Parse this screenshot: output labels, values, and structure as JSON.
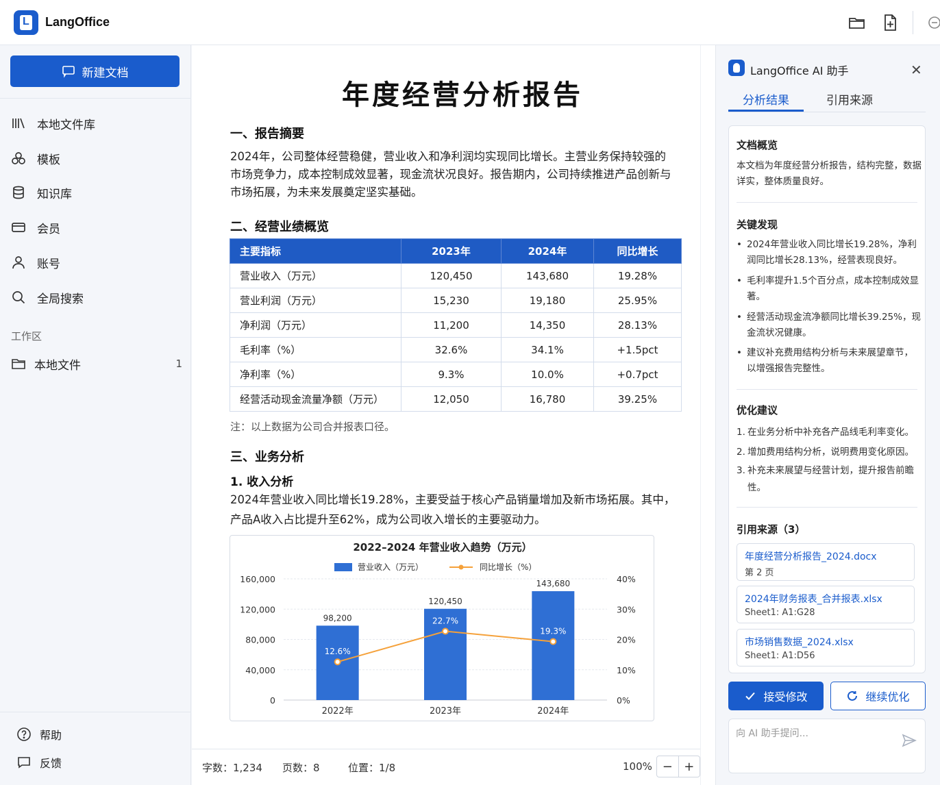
{
  "app": {
    "title": "LangOffice"
  },
  "colors": {
    "primary": "#1a5ccc",
    "line": "#f5a13a",
    "bar": "#2f6fd4"
  },
  "sidebar": {
    "new_doc": "新建文档",
    "items": [
      {
        "label": "本地文件库",
        "icon": "library-icon"
      },
      {
        "label": "模板",
        "icon": "template-icon"
      },
      {
        "label": "知识库",
        "icon": "database-icon"
      },
      {
        "label": "会员",
        "icon": "card-icon"
      },
      {
        "label": "账号",
        "icon": "user-icon"
      },
      {
        "label": "全局搜索",
        "icon": "search-icon"
      }
    ],
    "workspace_label": "工作区",
    "workspace_item": {
      "label": "本地文件",
      "count": "1"
    },
    "help": "帮助",
    "feedback": "反馈"
  },
  "doc": {
    "title": "年度经营分析报告",
    "s1_title": "一、报告摘要",
    "s1_body": "2024年，公司整体经营稳健，营业收入和净利润均实现同比增长。主营业务保持较强的市场竞争力，成本控制成效显著，现金流状况良好。报告期内，公司持续推进产品创新与市场拓展，为未来发展奠定坚实基础。",
    "s2_title": "二、经营业绩概览",
    "table": {
      "headers": [
        "主要指标",
        "2023年",
        "2024年",
        "同比增长"
      ],
      "rows": [
        [
          "营业收入（万元）",
          "120,450",
          "143,680",
          "19.28%"
        ],
        [
          "营业利润（万元）",
          "15,230",
          "19,180",
          "25.95%"
        ],
        [
          "净利润（万元）",
          "11,200",
          "14,350",
          "28.13%"
        ],
        [
          "毛利率（%）",
          "32.6%",
          "34.1%",
          "+1.5pct"
        ],
        [
          "净利率（%）",
          "9.3%",
          "10.0%",
          "+0.7pct"
        ],
        [
          "经营活动现金流量净额（万元）",
          "12,050",
          "16,780",
          "39.25%"
        ]
      ]
    },
    "note": "注：以上数据为公司合并报表口径。",
    "s3_title": "三、业务分析",
    "s3_sub": "1. 收入分析",
    "s3_body": "2024年营业收入同比增长19.28%，主要受益于核心产品销量增加及新市场拓展。其中，产品A收入占比提升至62%，成为公司收入增长的主要驱动力。"
  },
  "chart_data": {
    "type": "bar",
    "title": "2022–2024 年营业收入趋势（万元）",
    "categories": [
      "2022年",
      "2023年",
      "2024年"
    ],
    "series": [
      {
        "name": "营业收入（万元）",
        "type": "bar",
        "values": [
          98200,
          120450,
          143680
        ],
        "labels": [
          "98,200",
          "120,450",
          "143,680"
        ]
      },
      {
        "name": "同比增长（%）",
        "type": "line",
        "values": [
          12.6,
          22.7,
          19.3
        ],
        "labels": [
          "12.6%",
          "22.7%",
          "19.3%"
        ]
      }
    ],
    "ylim": [
      0,
      160000
    ],
    "y2lim": [
      0,
      40
    ],
    "yticks": [
      "0",
      "40,000",
      "80,000",
      "120,000",
      "160,000"
    ],
    "y2ticks": [
      "0%",
      "10%",
      "20%",
      "30%",
      "40%"
    ],
    "grid": true,
    "legend": "top-center"
  },
  "status": {
    "words": "字数：1,234",
    "pages": "页数：8",
    "position": "位置：1/8",
    "zoom": "100%",
    "minus": "−",
    "plus": "+"
  },
  "ai": {
    "title": "LangOffice AI 助手",
    "tabs": [
      "分析结果",
      "引用来源"
    ],
    "overview_title": "文档概览",
    "overview_body": "本文档为年度经营分析报告，结构完整，数据详实，整体质量良好。",
    "findings_title": "关键发现",
    "findings": [
      "2024年营业收入同比增长19.28%，净利润同比增长28.13%，经营表现良好。",
      "毛利率提升1.5个百分点，成本控制成效显著。",
      "经营活动现金流净额同比增长39.25%，现金流状况健康。",
      "建议补充费用结构分析与未来展望章节，以增强报告完整性。"
    ],
    "suggest_title": "优化建议",
    "suggestions": [
      {
        "n": "1.",
        "text": "在业务分析中补充各产品线毛利率变化。"
      },
      {
        "n": "2.",
        "text": "增加费用结构分析，说明费用变化原因。"
      },
      {
        "n": "3.",
        "text": "补充未来展望与经营计划，提升报告前瞻性。"
      }
    ],
    "sources_title": "引用来源（3）",
    "sources": [
      {
        "file": "年度经营分析报告_2024.docx",
        "loc": "第 2 页"
      },
      {
        "file": "2024年财务报表_合并报表.xlsx",
        "loc": "Sheet1: A1:G28"
      },
      {
        "file": "市场销售数据_2024.xlsx",
        "loc": "Sheet1: A1:D56"
      }
    ],
    "accept": "接受修改",
    "continue": "继续优化",
    "ask_placeholder": "向 AI 助手提问..."
  }
}
